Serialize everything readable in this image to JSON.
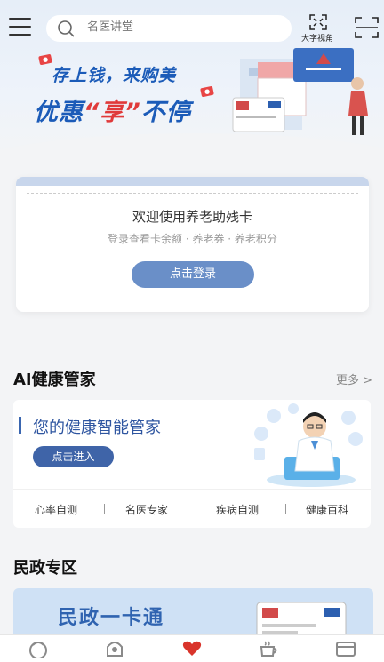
{
  "header": {
    "search": {
      "placeholder": "名医讲堂"
    },
    "big_font_label": "大字视角"
  },
  "banner": {
    "line1": "存上钱，来购美",
    "line2_part1": "优惠",
    "line2_highlight": "“享”",
    "line2_part2": "不停"
  },
  "login_card": {
    "title": "欢迎使用养老助残卡",
    "subtitle": "登录查看卡余额 · 养老券 · 养老积分",
    "button": "点击登录"
  },
  "ai_section": {
    "title": "AI健康管家",
    "more": "更多 >",
    "card_title": "您的健康智能管家",
    "card_button": "点击进入",
    "links": [
      "心率自测",
      "名医专家",
      "疾病自测",
      "健康百科"
    ]
  },
  "minzheng_section": {
    "title": "民政专区",
    "card_text": "民政一卡通"
  },
  "bottom_nav": {
    "items": [
      {
        "icon": "home-icon"
      },
      {
        "icon": "finance-icon"
      },
      {
        "icon": "care-icon",
        "active": true
      },
      {
        "icon": "life-icon"
      },
      {
        "icon": "card-icon"
      }
    ]
  },
  "colors": {
    "primary_blue": "#2e55a0",
    "login_button": "#6a8fc8",
    "active_red": "#d9342b"
  }
}
